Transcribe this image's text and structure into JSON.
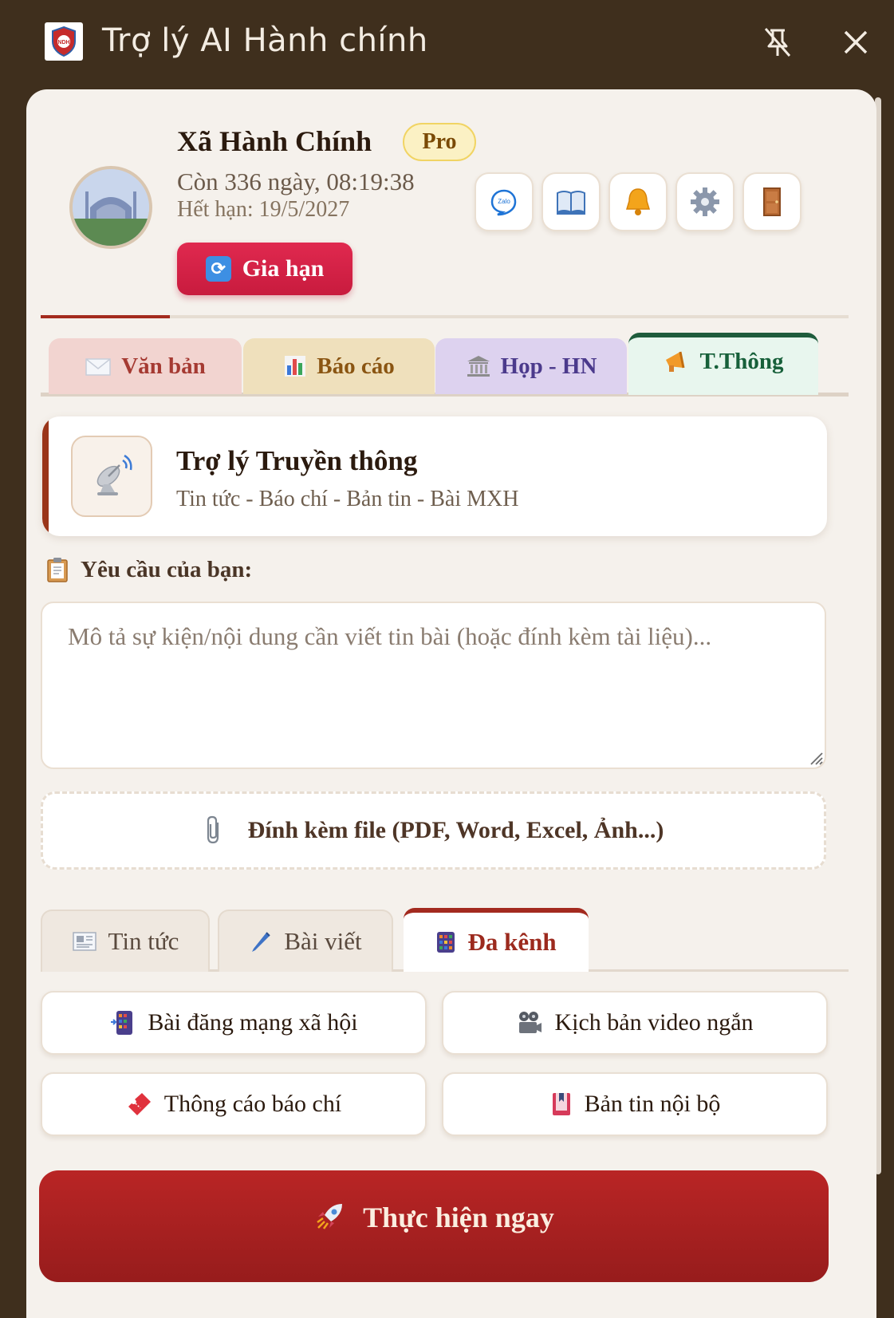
{
  "window": {
    "title": "Trợ lý AI Hành chính"
  },
  "profile": {
    "name": "Xã Hành Chính",
    "plan_badge": "Pro",
    "remaining": "Còn 336 ngày, 08:19:38",
    "expiry": "Hết hạn: 19/5/2027",
    "renew_label": "Gia hạn",
    "subscription_progress": 0.16
  },
  "toolbar": {
    "zalo_label": "Zalo",
    "icons": [
      "zalo-icon",
      "book-icon",
      "bell-icon",
      "gear-icon",
      "door-icon"
    ]
  },
  "section_tabs": [
    {
      "label": "Văn bản",
      "icon": "envelope-icon",
      "color": "#a53a32",
      "bg": "#f2d4d0"
    },
    {
      "label": "Báo cáo",
      "icon": "bar-chart-icon",
      "color": "#8a5512",
      "bg": "#efe0bc"
    },
    {
      "label": "Họp - HN",
      "icon": "classical-building-icon",
      "color": "#4b3a8c",
      "bg": "#ddd2ef"
    },
    {
      "label": "T.Thông",
      "icon": "megaphone-icon",
      "color": "#17603a",
      "bg": "#e8f6ee",
      "active": true
    }
  ],
  "assistant": {
    "title": "Trợ lý Truyền thông",
    "subtitle": "Tin tức - Báo chí - Bản tin - Bài MXH"
  },
  "request": {
    "label": "Yêu cầu của bạn:",
    "placeholder": "Mô tả sự kiện/nội dung cần viết tin bài (hoặc đính kèm tài liệu)...",
    "value": ""
  },
  "attach": {
    "label": "Đính kèm file (PDF, Word, Excel, Ảnh...)"
  },
  "sub_tabs": [
    {
      "label": "Tin tức",
      "icon": "newspaper-icon"
    },
    {
      "label": "Bài viết",
      "icon": "pen-icon"
    },
    {
      "label": "Đa kênh",
      "icon": "grid-icon",
      "active": true
    }
  ],
  "options": [
    {
      "label": "Bài đăng mạng xã hội",
      "icon": "mobile-app-icon"
    },
    {
      "label": "Kịch bản video ngắn",
      "icon": "film-camera-icon"
    },
    {
      "label": "Thông cáo báo chí",
      "icon": "ticket-icon"
    },
    {
      "label": "Bản tin nội bộ",
      "icon": "bookmark-book-icon"
    }
  ],
  "run_button": {
    "label": "Thực hiện ngay",
    "icon": "rocket-icon"
  },
  "colors": {
    "accent_red": "#c81b3e",
    "frame": "#3f2f1d",
    "run": "#a52020"
  }
}
